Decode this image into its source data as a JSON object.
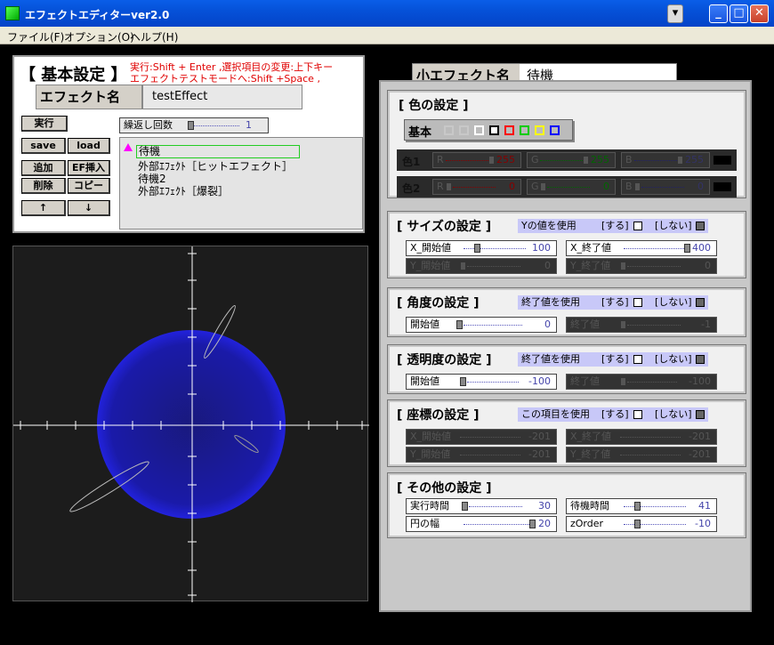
{
  "window": {
    "title": "エフェクトエディターver2.0",
    "min": "_",
    "max": "□",
    "close": "✕"
  },
  "menu": [
    "ファイル(F)",
    "オプション(O)",
    "ヘルプ(H)"
  ],
  "basic": {
    "title": "【 基本設定 】",
    "hint1": "実行:Shift + Enter ,選択項目の変更:上下キー",
    "hint2": "エフェクトテストモードへ:Shift +Space ,",
    "name_label": "エフェクト名",
    "name_value": "testEffect",
    "repeat_label": "繰返し回数",
    "repeat_value": "1"
  },
  "buttons": {
    "run": "実行",
    "save": "save",
    "load": "load",
    "add": "追加",
    "ef_insert": "EF挿入",
    "delete": "削除",
    "copy": "コピー",
    "up": "↑",
    "down": "↓"
  },
  "list": [
    "待機",
    "外部ｴﾌｪｸﾄ［ヒットエフェクト］",
    "待機2",
    "外部ｴﾌｪｸﾄ［爆裂］"
  ],
  "sub": {
    "label": "小エフェクト名",
    "value": "待機"
  },
  "color": {
    "title": "[ 色の設定 ]",
    "basic": "基本",
    "c1": "色1",
    "c2": "色2",
    "swatches": [
      "#c8c8c8",
      "#c8c8c8",
      "#ffffff",
      "#000000",
      "#ff0000",
      "#00cc00",
      "#ffff00",
      "#0000ff"
    ],
    "c1vals": {
      "r_label": "R",
      "r": "255",
      "g_label": "G",
      "g": "255",
      "b_label": "B",
      "b": "255"
    },
    "c2vals": {
      "r_label": "R",
      "r": "0",
      "g_label": "G",
      "g": "0",
      "b_label": "B",
      "b": "0"
    }
  },
  "size": {
    "title": "[ サイズの設定 ]",
    "opt": "Yの値を使用",
    "yes": "[する]",
    "no": "[しない]",
    "xs_label": "X_開始値",
    "xs": "100",
    "xe_label": "X_終了値",
    "xe": "400",
    "ys_label": "Y_開始値",
    "ys": "0",
    "ye_label": "Y_終了値",
    "ye": "0"
  },
  "angle": {
    "title": "[ 角度の設定 ]",
    "opt": "終了値を使用",
    "yes": "[する]",
    "no": "[しない]",
    "s_label": "開始値",
    "s": "0",
    "e_label": "終了値",
    "e": "-1"
  },
  "alpha": {
    "title": "[ 透明度の設定 ]",
    "opt": "終了値を使用",
    "yes": "[する]",
    "no": "[しない]",
    "s_label": "開始値",
    "s": "-100",
    "e_label": "終了値",
    "e": "-100"
  },
  "coord": {
    "title": "[ 座標の設定 ]",
    "opt": "この項目を使用",
    "yes": "[する]",
    "no": "[しない]",
    "xs_label": "X_開始値",
    "xs": "-201",
    "xe_label": "X_終了値",
    "xe": "-201",
    "ys_label": "Y_開始値",
    "ys": "-201",
    "ye_label": "Y_終了値",
    "ye": "-201"
  },
  "other": {
    "title": "[ その他の設定 ]",
    "run_label": "実行時間",
    "run": "30",
    "wait_label": "待機時間",
    "wait": "41",
    "circle_label": "円の幅",
    "circle": "20",
    "z_label": "zOrder",
    "z": "-10"
  }
}
